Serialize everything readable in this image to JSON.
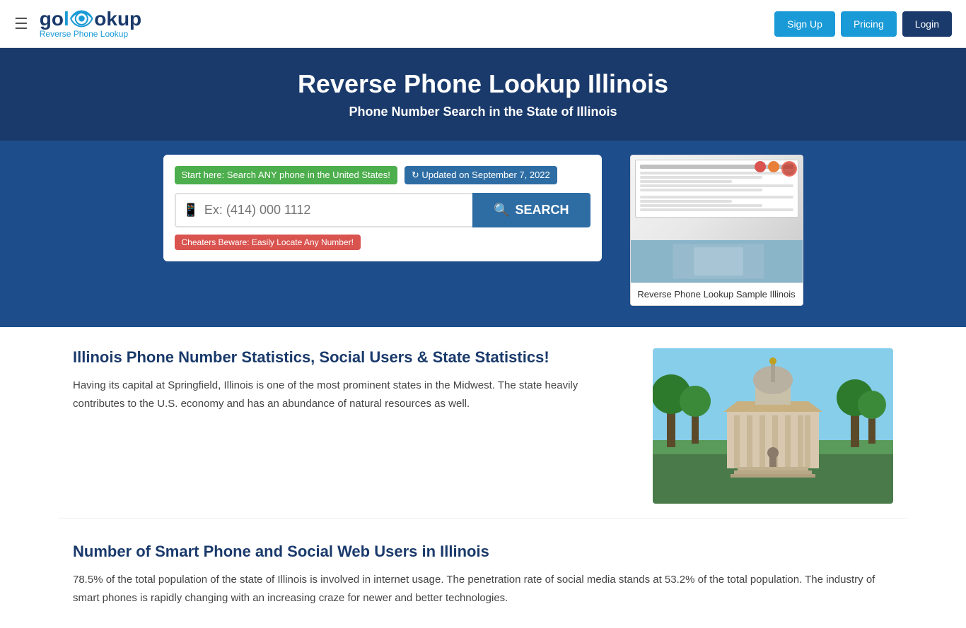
{
  "header": {
    "hamburger_label": "☰",
    "logo_part1": "go",
    "logo_eye": "l👁",
    "logo_part2": "okup",
    "logo_subtitle": "Reverse Phone Lookup",
    "signup_label": "Sign Up",
    "pricing_label": "Pricing",
    "login_label": "Login"
  },
  "hero": {
    "title": "Reverse Phone Lookup Illinois",
    "subtitle": "Phone Number Search in the State of Illinois"
  },
  "search": {
    "label_green": "Start here: Search ANY phone in the United States!",
    "label_blue": "↻ Updated on September 7, 2022",
    "placeholder": "Ex: (414) 000 1112",
    "search_button_label": "SEARCH",
    "cheaters_label": "Cheaters Beware: Easily Locate Any Number!"
  },
  "sample_report": {
    "caption": "Reverse Phone Lookup Sample Illinois"
  },
  "section1": {
    "title": "Illinois Phone Number Statistics, Social Users & State Statistics!",
    "text": "Having its capital at Springfield, Illinois is one of the most prominent states in the Midwest. The state heavily contributes to the U.S. economy and has an abundance of natural resources as well."
  },
  "section2": {
    "title": "Number of Smart Phone and Social Web Users in Illinois",
    "text": "78.5% of the total population of the state of Illinois is involved in internet usage. The penetration rate of social media stands at 53.2% of the total population. The industry of smart phones is rapidly changing with an increasing craze for newer and better technologies."
  }
}
